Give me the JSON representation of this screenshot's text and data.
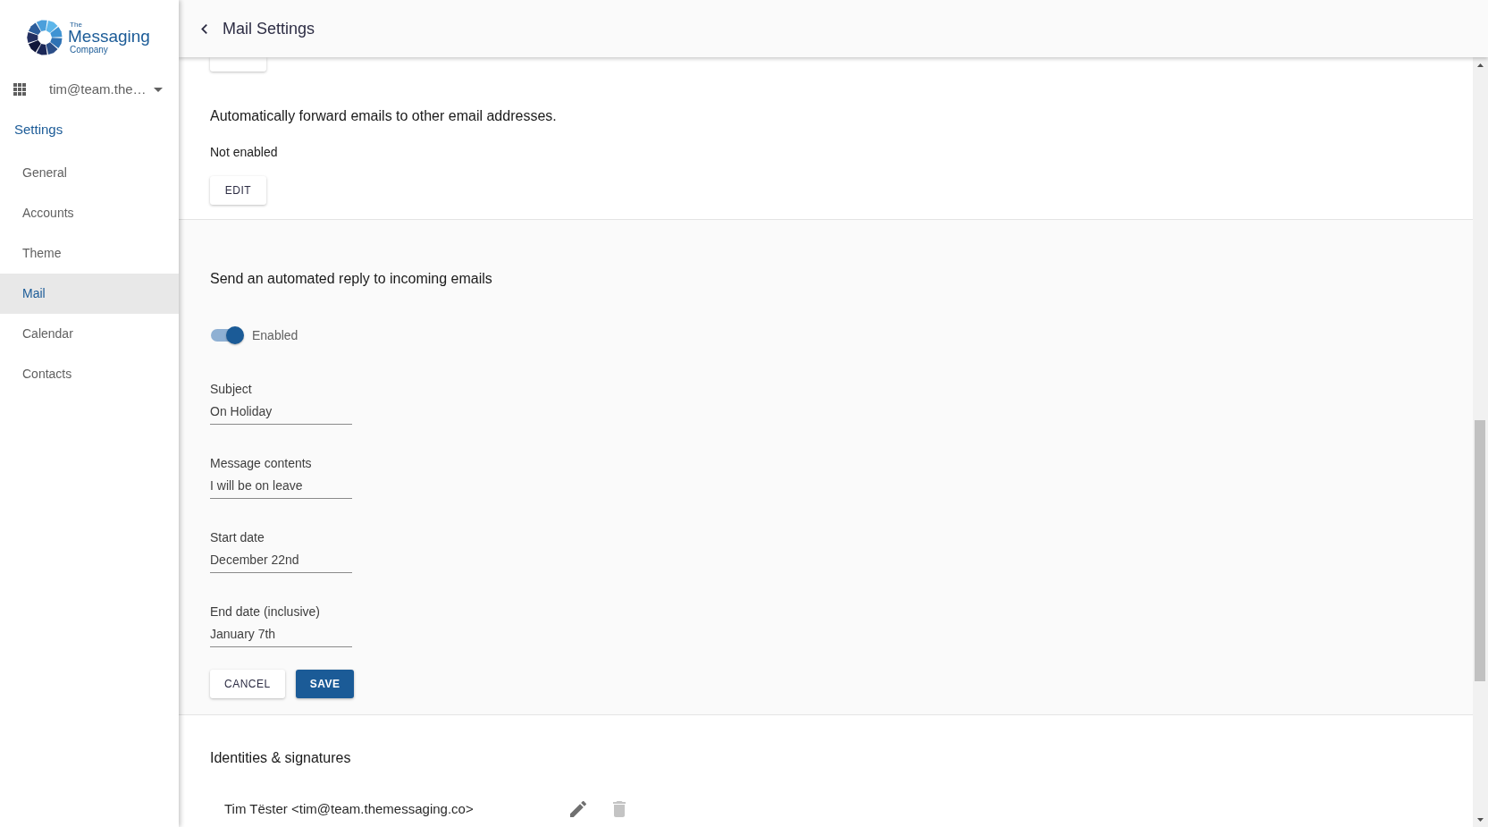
{
  "sidebar": {
    "logo": {
      "top": "The",
      "main": "Messaging",
      "bottom": "Company"
    },
    "account": {
      "label": "tim@team.the…"
    },
    "heading": "Settings",
    "items": [
      {
        "label": "General",
        "selected": false
      },
      {
        "label": "Accounts",
        "selected": false
      },
      {
        "label": "Theme",
        "selected": false
      },
      {
        "label": "Mail",
        "selected": true
      },
      {
        "label": "Calendar",
        "selected": false
      },
      {
        "label": "Contacts",
        "selected": false
      }
    ]
  },
  "header": {
    "title": "Mail Settings"
  },
  "content": {
    "forwarding": {
      "heading": "Automatically forward emails to other email addresses.",
      "status": "Not enabled",
      "button": "EDIT"
    },
    "auto_reply": {
      "heading": "Send an automated reply to incoming emails",
      "toggle": {
        "on": true,
        "label": "Enabled"
      },
      "fields": [
        {
          "label": "Subject",
          "value": "On Holiday"
        },
        {
          "label": "Message contents",
          "value": "I will be on leave"
        },
        {
          "label": "Start date",
          "value": "December 22nd"
        },
        {
          "label": "End date (inclusive)",
          "value": "January 7th"
        }
      ],
      "buttons": [
        {
          "label": "CANCEL",
          "kind": "secondary"
        },
        {
          "label": "SAVE",
          "kind": "primary"
        }
      ]
    },
    "identities": {
      "heading": "Identities & signatures",
      "items": [
        {
          "text": "Tim Tëster <tim@team.themessaging.co>",
          "delete_disabled": true
        }
      ]
    }
  }
}
